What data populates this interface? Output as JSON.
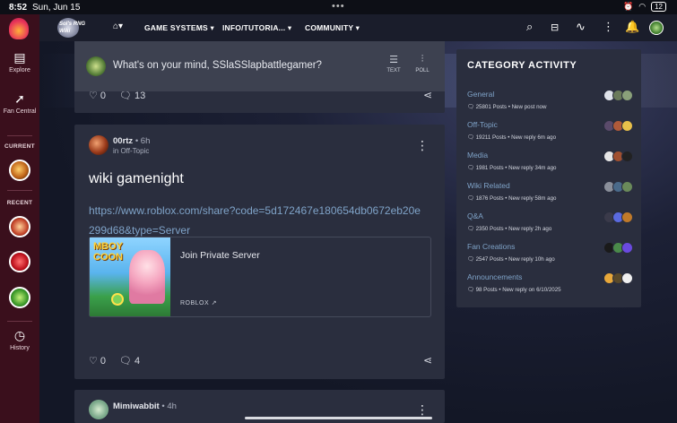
{
  "status_bar": {
    "time": "8:52",
    "date": "Sun, Jun 15",
    "battery": "12"
  },
  "sidebar": {
    "explore": "Explore",
    "fan_central": "Fan Central",
    "current": "CURRENT",
    "recent": "RECENT",
    "history": "History"
  },
  "nav": {
    "logo_text": "Sol's RNG Wiki",
    "items": [
      "GAME SYSTEMS",
      "INFO/TUTORIA...",
      "COMMUNITY"
    ]
  },
  "composer": {
    "placeholder": "What's on your mind, SSlaSSlapbattlegamer?",
    "text_label": "TEXT",
    "poll_label": "POLL"
  },
  "prev_post": {
    "likes": "0",
    "comments": "13"
  },
  "post": {
    "author": "00rtz",
    "time": "6h",
    "category": "in Off-Topic",
    "title": "wiki gamenight",
    "link": "https://www.roblox.com/share?code=5d172467e180654db0672eb20e299d68&type=Server",
    "embed_thumb_text": "MBOY COON",
    "embed_title": "Join Private Server",
    "embed_source": "ROBLOX",
    "likes": "0",
    "comments": "4"
  },
  "next_post": {
    "author": "Mimiwabbit",
    "time": "4h"
  },
  "category_activity": {
    "title": "CATEGORY ACTIVITY",
    "items": [
      {
        "name": "General",
        "posts": "25801 Posts",
        "latest": "New post now"
      },
      {
        "name": "Off-Topic",
        "posts": "19211 Posts",
        "latest": "New reply 6m ago"
      },
      {
        "name": "Media",
        "posts": "1981 Posts",
        "latest": "New reply 34m ago"
      },
      {
        "name": "Wiki Related",
        "posts": "1876 Posts",
        "latest": "New reply 58m ago"
      },
      {
        "name": "Q&A",
        "posts": "2350 Posts",
        "latest": "New reply 2h ago"
      },
      {
        "name": "Fan Creations",
        "posts": "2547 Posts",
        "latest": "New reply 10h ago"
      },
      {
        "name": "Announcements",
        "posts": "98 Posts",
        "latest": "New reply on 6/10/2025"
      }
    ]
  },
  "colors": {
    "sidebar": "#3a0f1c",
    "accent": "#7fa3c8",
    "card": "#2a2e3e"
  }
}
